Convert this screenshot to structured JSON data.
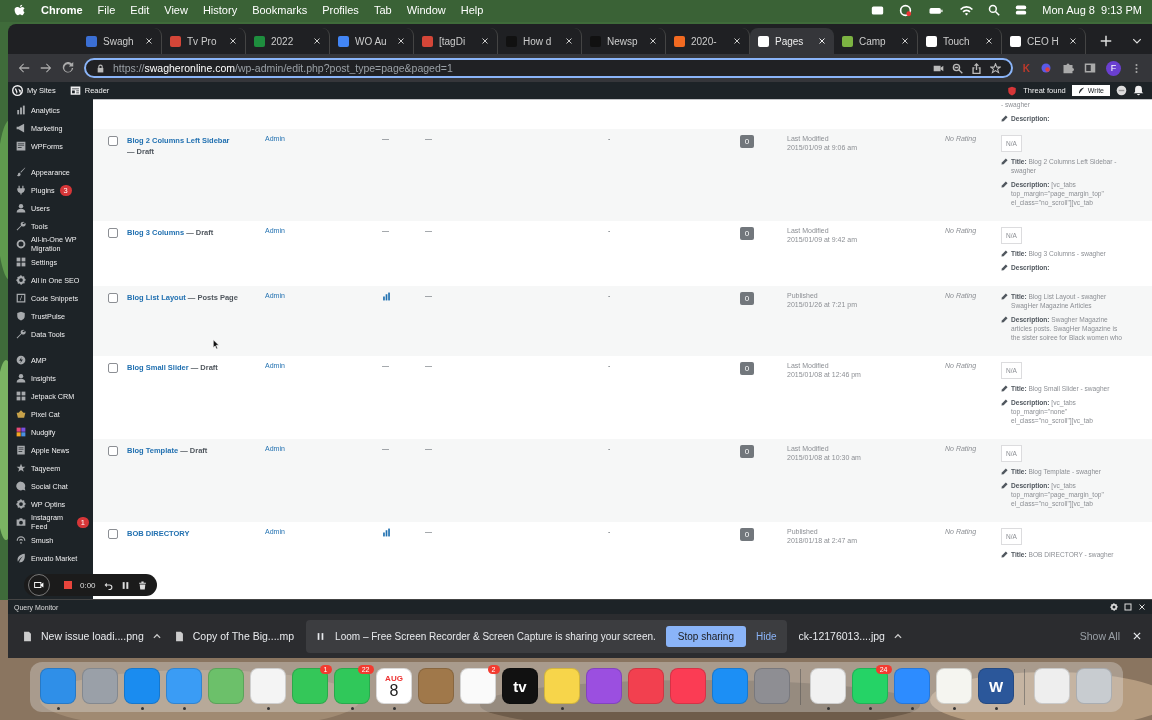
{
  "menu_bar": {
    "app": "Chrome",
    "items": [
      "File",
      "Edit",
      "View",
      "History",
      "Bookmarks",
      "Profiles",
      "Tab",
      "Window",
      "Help"
    ],
    "clock": "Mon Aug 8  9:13 PM"
  },
  "tabs": [
    {
      "label": "Swagh",
      "color": "#3b6fd4",
      "selected": false
    },
    {
      "label": "Tv Pro",
      "color": "#d44638",
      "selected": false
    },
    {
      "label": "2022",
      "color": "#1e8e3e",
      "selected": false
    },
    {
      "label": "WO Au",
      "color": "#4285f4",
      "selected": false
    },
    {
      "label": "[tagDi",
      "color": "#d44638",
      "selected": false
    },
    {
      "label": "How d",
      "color": "#111111",
      "selected": false
    },
    {
      "label": "Newsp",
      "color": "#111111",
      "selected": false
    },
    {
      "label": "2020-",
      "color": "#f26a21",
      "selected": false
    },
    {
      "label": "Pages",
      "color": "#ffffff",
      "selected": true
    },
    {
      "label": "Camp",
      "color": "#7cb342",
      "selected": false
    },
    {
      "label": "Touch",
      "color": "#ffffff",
      "selected": false
    },
    {
      "label": "CEO H",
      "color": "#ffffff",
      "selected": false
    }
  ],
  "address": {
    "url": "https://**swagheronline.com**/wp-admin/edit.php?post_type=page&paged=1"
  },
  "toolbar": {
    "extension_letter": "K",
    "profile_initial": "F"
  },
  "admin_bar": {
    "items": [
      "My Sites",
      "Reader"
    ],
    "threat": "Threat found",
    "write": "Write"
  },
  "sidebar": {
    "groups": [
      [
        {
          "label": "Analytics"
        },
        {
          "label": "Marketing"
        },
        {
          "label": "WPForms"
        }
      ],
      [
        {
          "label": "Appearance"
        },
        {
          "label": "Plugins",
          "badge": "3"
        },
        {
          "label": "Users"
        },
        {
          "label": "Tools"
        },
        {
          "label": "All-in-One WP Migration"
        },
        {
          "label": "Settings"
        },
        {
          "label": "All in One SEO"
        },
        {
          "label": "Code Snippets"
        },
        {
          "label": "TrustPulse"
        },
        {
          "label": "Data Tools"
        }
      ],
      [
        {
          "label": "AMP"
        },
        {
          "label": "Insights"
        },
        {
          "label": "Jetpack CRM"
        },
        {
          "label": "Pixel Cat"
        },
        {
          "label": "Nudgify"
        },
        {
          "label": "Apple News"
        },
        {
          "label": "Taqyeem"
        },
        {
          "label": "Social Chat"
        },
        {
          "label": "WP Optins"
        },
        {
          "label": "Instagram Feed",
          "badge": "1"
        },
        {
          "label": "Smush"
        },
        {
          "label": "Envato Market"
        }
      ]
    ]
  },
  "table": {
    "top_row": {
      "seo_title_tail": "- swagher",
      "seo_description_label": "Description:"
    },
    "rows": [
      {
        "checked": false,
        "title": "Blog 2 Columns Left Sidebar",
        "state": "— Draft",
        "author": "Admin",
        "stats": false,
        "col3": "—",
        "col4": "—",
        "col5": "-",
        "comments": "0",
        "date_status": "Last Modified",
        "date": "2015/01/09 at 9:06 am",
        "rating": "No Rating",
        "seo_score": "N/A",
        "seo_title_label": "Title:",
        "seo_title": "Blog 2 Columns Left Sidebar - swagher",
        "seo_description_label": "Description:",
        "seo_description": "[vc_tabs top_margin=\"page_margin_top\" el_class=\"no_scroll\"][vc_tab"
      },
      {
        "checked": false,
        "title": "Blog 3 Columns",
        "state": "— Draft",
        "author": "Admin",
        "stats": false,
        "col3": "—",
        "col4": "—",
        "col5": "-",
        "comments": "0",
        "date_status": "Last Modified",
        "date": "2015/01/09 at 9:42 am",
        "rating": "No Rating",
        "seo_score": "N/A",
        "seo_title_label": "Title:",
        "seo_title": "Blog 3 Columns - swagher",
        "seo_description_label": "Description:"
      },
      {
        "checked": false,
        "title": "Blog List Layout",
        "state": "— Posts Page",
        "author": "Admin",
        "stats": true,
        "col4": "—",
        "col5": "-",
        "comments": "0",
        "date_status": "Published",
        "date": "2015/01/26 at 7:21 pm",
        "rating": "No Rating",
        "seo_title_label": "Title:",
        "seo_title": "Blog List Layout - swagher SwagHer Magazine Articles",
        "seo_description_label": "Description:",
        "seo_description": "Swagher Magazine articles posts. SwagHer Magazine is the sister soiree for Black women who"
      },
      {
        "checked": false,
        "title": "Blog Small Slider",
        "state": "— Draft",
        "author": "Admin",
        "stats": false,
        "col3": "—",
        "col4": "—",
        "col5": "-",
        "comments": "0",
        "date_status": "Last Modified",
        "date": "2015/01/08 at 12:46 pm",
        "rating": "No Rating",
        "seo_score": "N/A",
        "seo_title_label": "Title:",
        "seo_title": "Blog Small Slider - swagher",
        "seo_description_label": "Description:",
        "seo_description": "[vc_tabs top_margin=\"none\" el_class=\"no_scroll\"][vc_tab"
      },
      {
        "checked": false,
        "title": "Blog Template",
        "state": "— Draft",
        "author": "Admin",
        "stats": false,
        "col3": "—",
        "col4": "—",
        "col5": "-",
        "comments": "0",
        "date_status": "Last Modified",
        "date": "2015/01/08 at 10:30 am",
        "rating": "No Rating",
        "seo_score": "N/A",
        "seo_title_label": "Title:",
        "seo_title": "Blog Template - swagher",
        "seo_description_label": "Description:",
        "seo_description": "[vc_tabs top_margin=\"page_margin_top\" el_class=\"no_scroll\"][vc_tab"
      },
      {
        "checked": false,
        "title": "BOB DIRECTORY",
        "author": "Admin",
        "stats": true,
        "col4": "—",
        "col5": "-",
        "comments": "0",
        "date_status": "Published",
        "date": "2018/01/18 at 2:47 am",
        "rating": "No Rating",
        "seo_score": "N/A",
        "seo_title_label": "Title:",
        "seo_title": "BOB DIRECTORY - swagher"
      }
    ]
  },
  "recorder": {
    "timer": "0:00"
  },
  "query_monitor": {
    "label": "Query Monitor"
  },
  "downloads": {
    "before": [
      {
        "name": "New issue loadi....png",
        "menu": true
      },
      {
        "name": "Copy of The Big....mp",
        "menu": false
      }
    ],
    "notice": {
      "text": "Loom – Free Screen Recorder & Screen Capture is sharing your screen.",
      "stop": "Stop sharing",
      "hide": "Hide"
    },
    "after": [
      {
        "name": "ck-12176013....jpg",
        "menu": true
      }
    ],
    "show_all": "Show All"
  },
  "dock": [
    {
      "kind": "app",
      "color": "#2f8fe8",
      "running": true
    },
    {
      "kind": "app",
      "color": "#9aa0a8",
      "running": false
    },
    {
      "kind": "app",
      "color": "#1a8cf0",
      "running": true
    },
    {
      "kind": "app",
      "color": "#3a9cf5",
      "running": true
    },
    {
      "kind": "app",
      "color": "#6cc06a",
      "running": false
    },
    {
      "kind": "app",
      "color": "#f4f4f4",
      "running": true
    },
    {
      "kind": "app",
      "color": "#34c759",
      "running": false,
      "badge": "1"
    },
    {
      "kind": "app",
      "color": "#30c85a",
      "running": true,
      "badge": "22"
    },
    {
      "kind": "app",
      "color": "#ffffff",
      "running": true,
      "month": "AUG",
      "text": "8"
    },
    {
      "kind": "app",
      "color": "#a0784a",
      "running": false
    },
    {
      "kind": "app",
      "color": "#fafafa",
      "running": false,
      "badge": "2"
    },
    {
      "kind": "app",
      "color": "#111111",
      "running": false,
      "text": "tv"
    },
    {
      "kind": "app",
      "color": "#f7d54a",
      "running": true
    },
    {
      "kind": "app",
      "color": "#9b4fe0",
      "running": false
    },
    {
      "kind": "app",
      "color": "#f2404f",
      "running": false
    },
    {
      "kind": "app",
      "color": "#fb3c54",
      "running": false
    },
    {
      "kind": "app",
      "color": "#1c8ff5",
      "running": false
    },
    {
      "kind": "app",
      "color": "#8e8e93",
      "running": false
    },
    {
      "kind": "separator"
    },
    {
      "kind": "app",
      "color": "#f1f1f1",
      "running": true
    },
    {
      "kind": "app",
      "color": "#25d366",
      "running": true,
      "badge": "24"
    },
    {
      "kind": "app",
      "color": "#2d8cff",
      "running": true
    },
    {
      "kind": "app",
      "color": "#f5f5f0",
      "running": true
    },
    {
      "kind": "app",
      "color": "#2b579a",
      "running": true,
      "text": "W"
    },
    {
      "kind": "separator"
    },
    {
      "kind": "app",
      "color": "#eeeeee",
      "running": false
    },
    {
      "kind": "app",
      "color": "#c8ccd0",
      "running": false
    }
  ]
}
